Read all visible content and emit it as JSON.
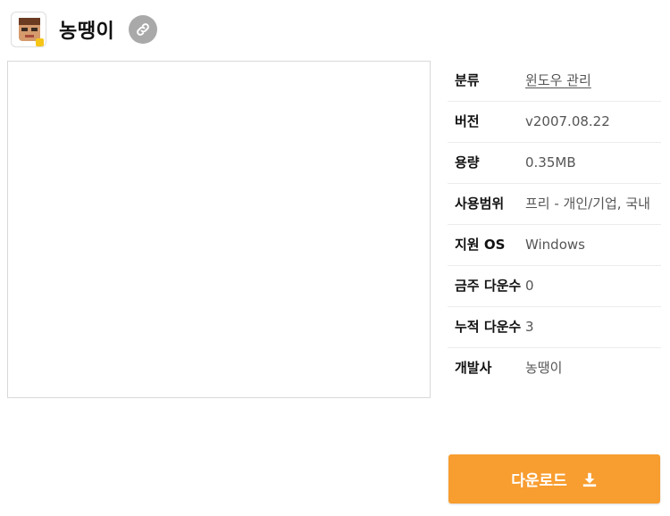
{
  "app": {
    "title": "농땡이",
    "icon": "app-logo-face",
    "link_icon": "link-icon"
  },
  "info": [
    {
      "key": "분류",
      "value": "윈도우 관리",
      "link": true
    },
    {
      "key": "버전",
      "value": "v2007.08.22"
    },
    {
      "key": "용량",
      "value": "0.35MB"
    },
    {
      "key": "사용범위",
      "value": "프리 - 개인/기업, 국내"
    },
    {
      "key": "지원 OS",
      "value": "Windows"
    },
    {
      "key": "금주 다운수",
      "value": "0"
    },
    {
      "key": "누적 다운수",
      "value": "3"
    },
    {
      "key": "개발사",
      "value": "농땡이"
    }
  ],
  "download": {
    "label": "다운로드",
    "icon": "download-icon",
    "color": "#f89d2f"
  }
}
